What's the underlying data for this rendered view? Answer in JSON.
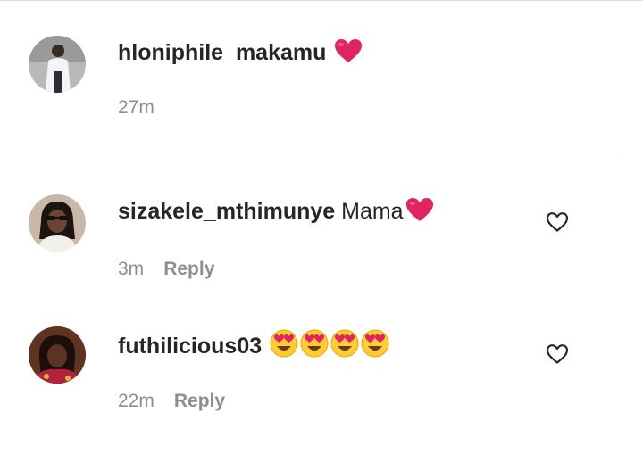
{
  "comments": [
    {
      "username": "hloniphile_makamu",
      "text": "",
      "emoji": "❤️",
      "time": "27m",
      "reply_label": ""
    },
    {
      "username": "sizakele_mthimunye",
      "text": "Mama",
      "emoji": "❤️",
      "time": "3m",
      "reply_label": "Reply"
    },
    {
      "username": "futhilicious03",
      "text": "",
      "emoji": "😍😍😍😍",
      "time": "22m",
      "reply_label": "Reply"
    }
  ],
  "icons": {
    "like": "heart-outline-icon",
    "heart_emoji": "red-heart-emoji",
    "face_emoji": "heart-eyes-emoji"
  },
  "colors": {
    "username": "#262626",
    "meta": "#8e8e8e",
    "heart": "#e0245e",
    "divider": "#dbdbdb"
  }
}
